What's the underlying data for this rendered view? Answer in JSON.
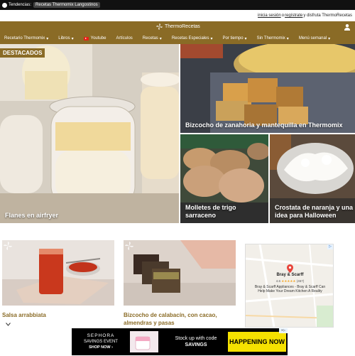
{
  "trending": {
    "label": "Tendencias:",
    "items": [
      "Recetas Thermomix Langostinos"
    ]
  },
  "login": {
    "login_link": "inicia sesión",
    "connector": "o",
    "register_link": "regístrate",
    "tail": "y disfruta ThermoRecetas"
  },
  "header": {
    "logo_text": "ThermoRecetas",
    "nav": [
      {
        "label": "Recetario Thermomix",
        "chevron": "▾"
      },
      {
        "label": "Libros",
        "chevron": "▾"
      },
      {
        "label": "Youtube",
        "chevron": ""
      },
      {
        "label": "Artículos",
        "chevron": ""
      },
      {
        "label": "Recetas",
        "chevron": "▾"
      },
      {
        "label": "Recetas Especiales",
        "chevron": "▾"
      },
      {
        "label": "Por tiempo",
        "chevron": "▾"
      },
      {
        "label": "Sin Thermomix",
        "chevron": "▾"
      },
      {
        "label": "Menú semanal",
        "chevron": "▾"
      }
    ]
  },
  "featured": {
    "badge": "DESTACADOS",
    "tiles": [
      {
        "title": "Flanes en airfryer"
      },
      {
        "title": "Bizcocho de zanahoria y mantequilla en Thermomix"
      },
      {
        "title": "Molletes de trigo sarraceno"
      },
      {
        "title": "Crostata de naranja y una idea para Halloween"
      }
    ]
  },
  "cards": [
    {
      "title": "Salsa arrabbiata"
    },
    {
      "title": "Bizcocho de calabacín, con cacao, almendras y pasas"
    }
  ],
  "map_ad": {
    "name": "Bray & Scarff",
    "rating": "4.6",
    "stars": "★★★★★",
    "reviews": "(467)",
    "description": "Bray & Scarff Appliances - Bray & Scarff Can Help Make Your Dream Kitchen A Reality"
  },
  "bottom_ad": {
    "brand": "SEPHORA",
    "event": "SAVINGS EVENT",
    "cta": "SHOP NOW ›",
    "stock_line": "Stock up with code",
    "code": "SAVINGS",
    "happening": "HAPPENING NOW"
  },
  "colors": {
    "brand": "#8a6b26",
    "topbar": "#111111",
    "youtube": "#e62117"
  },
  "icons": {
    "trend": "fire-icon",
    "logo": "pinwheel-logo",
    "user": "user-icon",
    "collapse": "chevron-down-icon"
  }
}
